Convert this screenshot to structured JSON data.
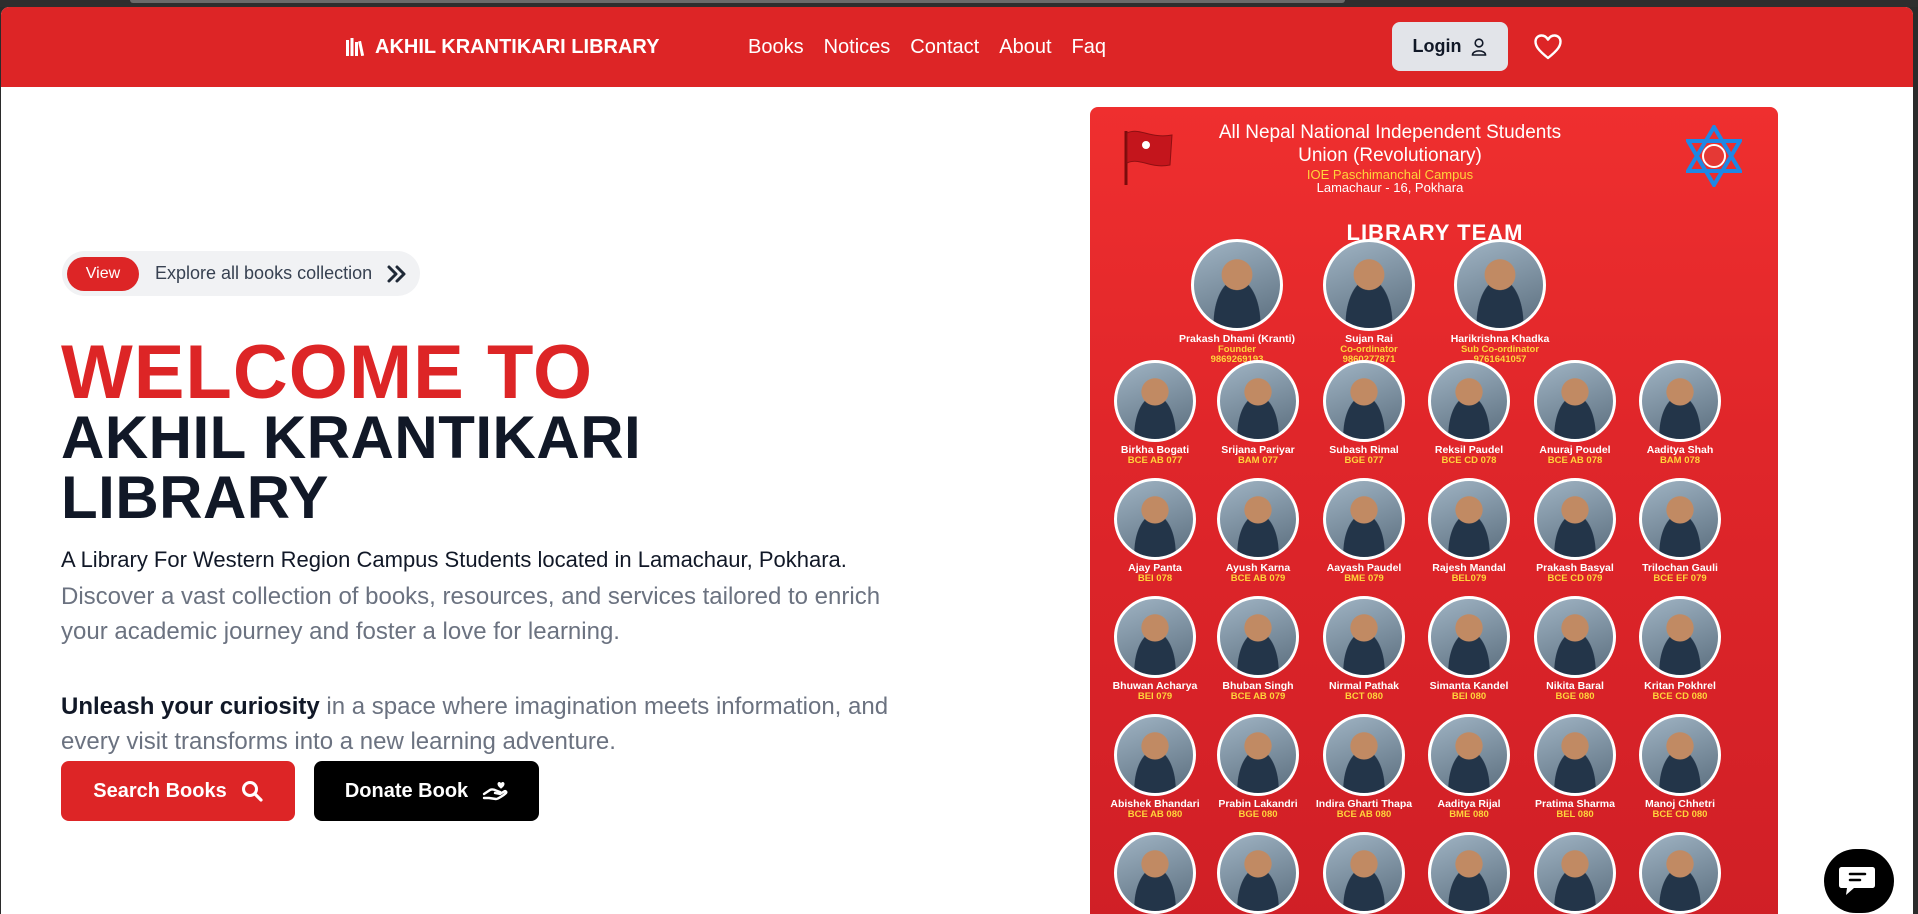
{
  "brand": {
    "name": "AKHIL KRANTIKARI LIBRARY",
    "icon": "library-books-icon"
  },
  "nav": {
    "links": [
      "Books",
      "Notices",
      "Contact",
      "About",
      "Faq"
    ]
  },
  "header": {
    "login_label": "Login",
    "login_icon": "user-icon",
    "favorites_icon": "heart-icon"
  },
  "colors": {
    "brand_red": "#dd2526",
    "dark_text": "#111827",
    "muted_text": "#6b7280",
    "poster_yellow": "#ffd43b"
  },
  "hero": {
    "pill": {
      "tag": "View",
      "text": "Explore all books collection",
      "icon": "double-chevron-right-icon"
    },
    "welcome": "WELCOME TO",
    "title": "AKHIL KRANTIKARI LIBRARY",
    "lead": "A Library For Western Region Campus Students located in Lamachaur, Pokhara.",
    "description": "Discover a vast collection of books, resources, and services tailored to enrich your academic journey and foster a love for learning.",
    "curiosity_strong": "Unleash your curiosity",
    "curiosity_rest": " in a space where imagination meets information, and every visit transforms into a new learning adventure.",
    "search_button": "Search Books",
    "donate_button": "Donate Book"
  },
  "poster": {
    "org": "All Nepal National Independent Students Union (Revolutionary)",
    "campus": "IOE Paschimanchal Campus",
    "place": "Lamachaur - 16, Pokhara",
    "team_title": "LIBRARY TEAM",
    "leaders": [
      {
        "name": "Prakash Dhami (Kranti)",
        "role": "Founder",
        "phone": "9869269193"
      },
      {
        "name": "Sujan Rai",
        "role": "Co-ordinator",
        "phone": "9860277871"
      },
      {
        "name": "Harikrishna Khadka",
        "role": "Sub Co-ordinator",
        "phone": "9761641057"
      }
    ],
    "members": [
      {
        "name": "Birkha Bogati",
        "batch": "BCE AB 077"
      },
      {
        "name": "Srijana Pariyar",
        "batch": "BAM 077"
      },
      {
        "name": "Subash Rimal",
        "batch": "BGE 077"
      },
      {
        "name": "Reksil Paudel",
        "batch": "BCE CD 078"
      },
      {
        "name": "Anuraj Poudel",
        "batch": "BCE AB 078"
      },
      {
        "name": "Aaditya Shah",
        "batch": "BAM 078"
      },
      {
        "name": "Ajay Panta",
        "batch": "BEI 078"
      },
      {
        "name": "Ayush Karna",
        "batch": "BCE AB 079"
      },
      {
        "name": "Aayash Paudel",
        "batch": "BME 079"
      },
      {
        "name": "Rajesh Mandal",
        "batch": "BEL079"
      },
      {
        "name": "Prakash Basyal",
        "batch": "BCE CD 079"
      },
      {
        "name": "Trilochan Gauli",
        "batch": "BCE EF 079"
      },
      {
        "name": "Bhuwan Acharya",
        "batch": "BEI 079"
      },
      {
        "name": "Bhuban Singh",
        "batch": "BCE AB 079"
      },
      {
        "name": "Nirmal Pathak",
        "batch": "BCT 080"
      },
      {
        "name": "Simanta Kandel",
        "batch": "BEI 080"
      },
      {
        "name": "Nikita Baral",
        "batch": "BGE 080"
      },
      {
        "name": "Kritan Pokhrel",
        "batch": "BCE CD 080"
      },
      {
        "name": "Abishek Bhandari",
        "batch": "BCE AB 080"
      },
      {
        "name": "Prabin Lakandri",
        "batch": "BGE 080"
      },
      {
        "name": "Indira Gharti Thapa",
        "batch": "BCE AB 080"
      },
      {
        "name": "Aaditya Rijal",
        "batch": "BME 080"
      },
      {
        "name": "Pratima Sharma",
        "batch": "BEL 080"
      },
      {
        "name": "Manoj Chhetri",
        "batch": "BCE CD 080"
      }
    ]
  },
  "chat": {
    "icon": "chat-bubble-icon"
  }
}
